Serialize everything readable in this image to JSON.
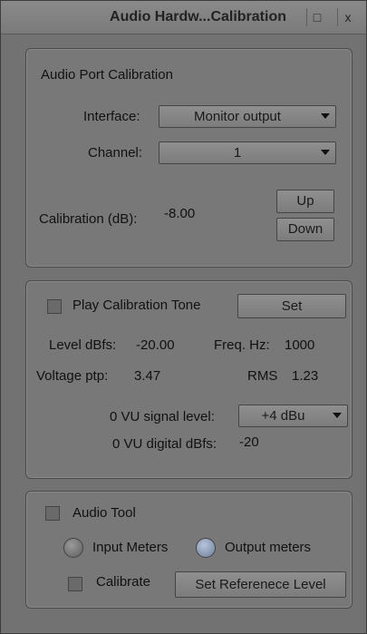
{
  "window": {
    "title": "Audio Hardw...Calibration",
    "restore_glyph": "□",
    "close_glyph": "x"
  },
  "calibration": {
    "header": "Audio Port Calibration",
    "interface_label": "Interface:",
    "interface_value": "Monitor output",
    "channel_label": "Channel:",
    "channel_value": "1",
    "calibration_label": "Calibration (dB):",
    "calibration_value": "-8.00",
    "up_label": "Up",
    "down_label": "Down"
  },
  "tone": {
    "play_label": "Play Calibration Tone",
    "set_label": "Set",
    "level_label": "Level dBfs:",
    "level_value": "-20.00",
    "freq_label": "Freq. Hz:",
    "freq_value": "1000",
    "voltage_label": "Voltage ptp:",
    "voltage_value": "3.47",
    "rms_label": "RMS",
    "rms_value": "1.23",
    "vu_signal_label": "0 VU signal level:",
    "vu_signal_value": "+4 dBu",
    "vu_digital_label": "0 VU digital dBfs:",
    "vu_digital_value": "-20"
  },
  "audio_tool": {
    "audio_tool_label": "Audio Tool",
    "input_meters_label": "Input Meters",
    "output_meters_label": "Output meters",
    "calibrate_label": "Calibrate",
    "set_reference_label": "Set Referenece Level",
    "selected_meter": "output"
  }
}
